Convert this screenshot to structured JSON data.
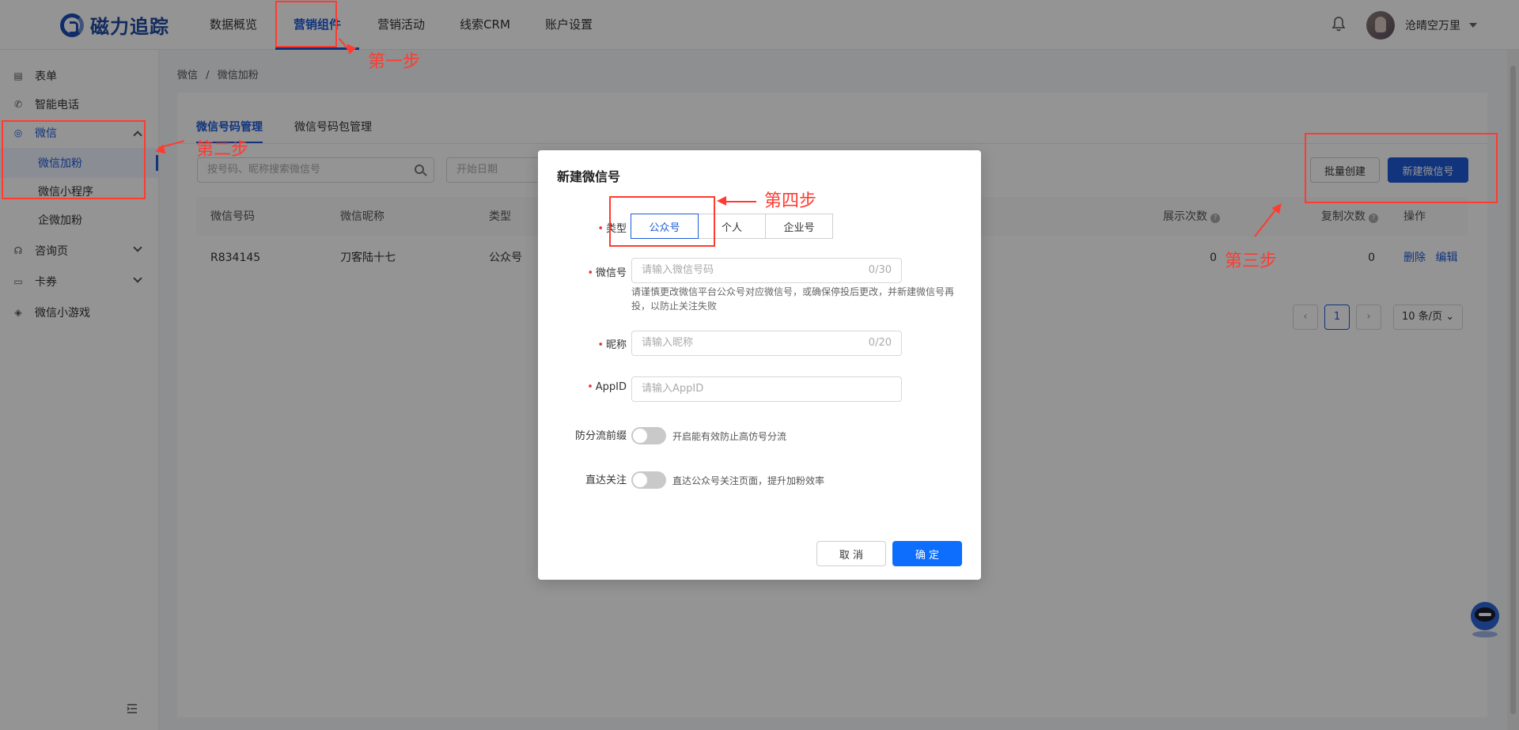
{
  "app": {
    "logo_text": "磁力追踪"
  },
  "topnav": [
    {
      "label": "数据概览",
      "active": false
    },
    {
      "label": "营销组件",
      "active": true
    },
    {
      "label": "营销活动",
      "active": false
    },
    {
      "label": "线索CRM",
      "active": false
    },
    {
      "label": "账户设置",
      "active": false
    }
  ],
  "user": {
    "name": "沧晴空万里"
  },
  "sidebar": {
    "items": [
      {
        "label": "表单",
        "icon": "form-icon"
      },
      {
        "label": "智能电话",
        "icon": "phone-icon"
      },
      {
        "label": "微信",
        "icon": "wechat-icon",
        "expanded": true
      },
      {
        "label": "微信加粉",
        "sub": true,
        "active": true
      },
      {
        "label": "微信小程序",
        "sub": true
      },
      {
        "label": "企微加粉",
        "sub": true
      },
      {
        "label": "咨询页",
        "icon": "headset-icon",
        "expandable": true
      },
      {
        "label": "卡券",
        "icon": "ticket-icon",
        "expandable": true
      },
      {
        "label": "微信小游戏",
        "icon": "gamepad-icon"
      }
    ]
  },
  "breadcrumb": [
    "微信",
    "/",
    "微信加粉"
  ],
  "tabs": [
    {
      "label": "微信号码管理",
      "active": true
    },
    {
      "label": "微信号码包管理",
      "active": false
    }
  ],
  "filters": {
    "search_placeholder": "按号码、昵称搜索微信号",
    "date_placeholder": "开始日期"
  },
  "actions": {
    "batch_create": "批量创建",
    "new_wechat": "新建微信号"
  },
  "table": {
    "headers": [
      "微信号码",
      "微信昵称",
      "类型",
      "展示次数",
      "复制次数",
      "操作"
    ],
    "rows": [
      {
        "number": "R834145",
        "nickname": "刀客陆十七",
        "type": "公众号",
        "views": "0",
        "copies": "0",
        "delete": "删除",
        "edit": "编辑"
      }
    ]
  },
  "pagination": {
    "current": "1",
    "page_size": "10 条/页"
  },
  "modal": {
    "title": "新建微信号",
    "type_label": "类型",
    "type_options": [
      "公众号",
      "个人",
      "企业号"
    ],
    "type_selected": "公众号",
    "wechat_label": "微信号",
    "wechat_placeholder": "请输入微信号码",
    "wechat_count": "0/30",
    "wechat_help": "请谨慎更改微信平台公众号对应微信号，或确保停投后更改，并新建微信号再投，以防止关注失败",
    "nickname_label": "昵称",
    "nickname_placeholder": "请输入昵称",
    "nickname_count": "0/20",
    "appid_label": "AppID",
    "appid_placeholder": "请输入AppID",
    "anti_label": "防分流前缀",
    "anti_help": "开启能有效防止高仿号分流",
    "anti_on": false,
    "direct_label": "直达关注",
    "direct_help": "直达公众号关注页面，提升加粉效率",
    "direct_on": false,
    "cancel": "取 消",
    "confirm": "确 定"
  },
  "annotations": {
    "step1": "第一步",
    "step2": "第二步",
    "step3": "第三步",
    "step4": "第四步",
    "color": "#ff3b30"
  }
}
